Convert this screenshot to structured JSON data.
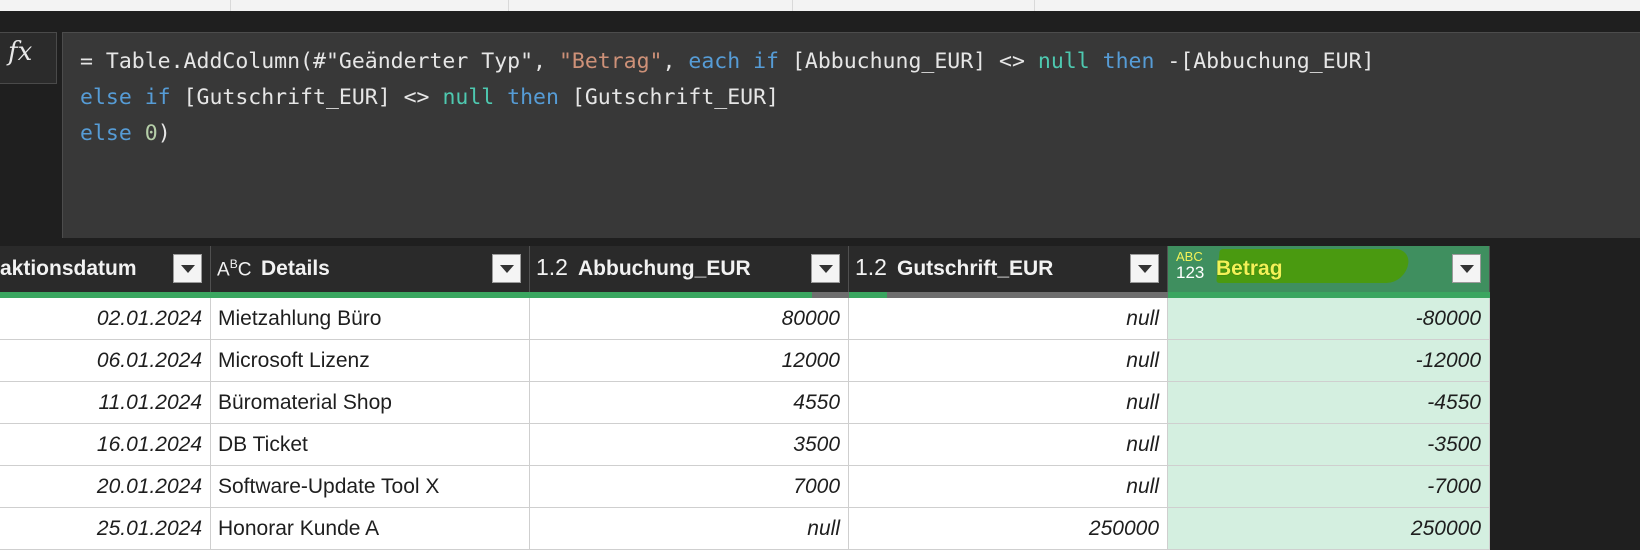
{
  "formula": {
    "fx_label": "fx",
    "line1": {
      "p1": "= Table.AddColumn(#\"Geänderter Typ\", ",
      "p2": "\"Betrag\"",
      "p3": ", ",
      "p4": "each if",
      "p5": " [Abbuchung_EUR] <> ",
      "p6": "null",
      "p7": " ",
      "p8": "then",
      "p9": " -[Abbuchung_EUR]"
    },
    "line2": {
      "p1": "else if",
      "p2": " [Gutschrift_EUR] <> ",
      "p3": "null",
      "p4": " ",
      "p5": "then",
      "p6": " [Gutschrift_EUR]"
    },
    "line3": {
      "p1": "else",
      "p2": " ",
      "p3": "0",
      "p4": ")"
    }
  },
  "columns": {
    "datum": {
      "title": "aktionsdatum"
    },
    "details": {
      "type_icon": "ABC",
      "title": "Details"
    },
    "abbuchung": {
      "type_icon": "1.2",
      "title": "Abbuchung_EUR"
    },
    "gutschrift": {
      "type_icon": "1.2",
      "title": "Gutschrift_EUR"
    },
    "betrag": {
      "type_top": "ABC",
      "type_bottom": "123",
      "title": "Betrag"
    }
  },
  "rows": [
    {
      "datum": "02.01.2024",
      "details": "Mietzahlung Büro",
      "abbuchung": "80000",
      "gutschrift": "null",
      "betrag": "-80000"
    },
    {
      "datum": "06.01.2024",
      "details": "Microsoft Lizenz",
      "abbuchung": "12000",
      "gutschrift": "null",
      "betrag": "-12000"
    },
    {
      "datum": "11.01.2024",
      "details": "Büromaterial Shop",
      "abbuchung": "4550",
      "gutschrift": "null",
      "betrag": "-4550"
    },
    {
      "datum": "16.01.2024",
      "details": "DB Ticket",
      "abbuchung": "3500",
      "gutschrift": "null",
      "betrag": "-3500"
    },
    {
      "datum": "20.01.2024",
      "details": "Software-Update Tool X",
      "abbuchung": "7000",
      "gutschrift": "null",
      "betrag": "-7000"
    },
    {
      "datum": "25.01.2024",
      "details": "Honorar Kunde A",
      "abbuchung": "null",
      "gutschrift": "250000",
      "betrag": "250000"
    }
  ],
  "colors": {
    "quality_valid": "#3aa660",
    "betrag_column": "#d4efe0",
    "highlight": "#4a9a10"
  },
  "icons": [
    "fx-icon",
    "dropdown-arrow-icon",
    "text-type-icon",
    "decimal-type-icon",
    "any-type-icon"
  ]
}
